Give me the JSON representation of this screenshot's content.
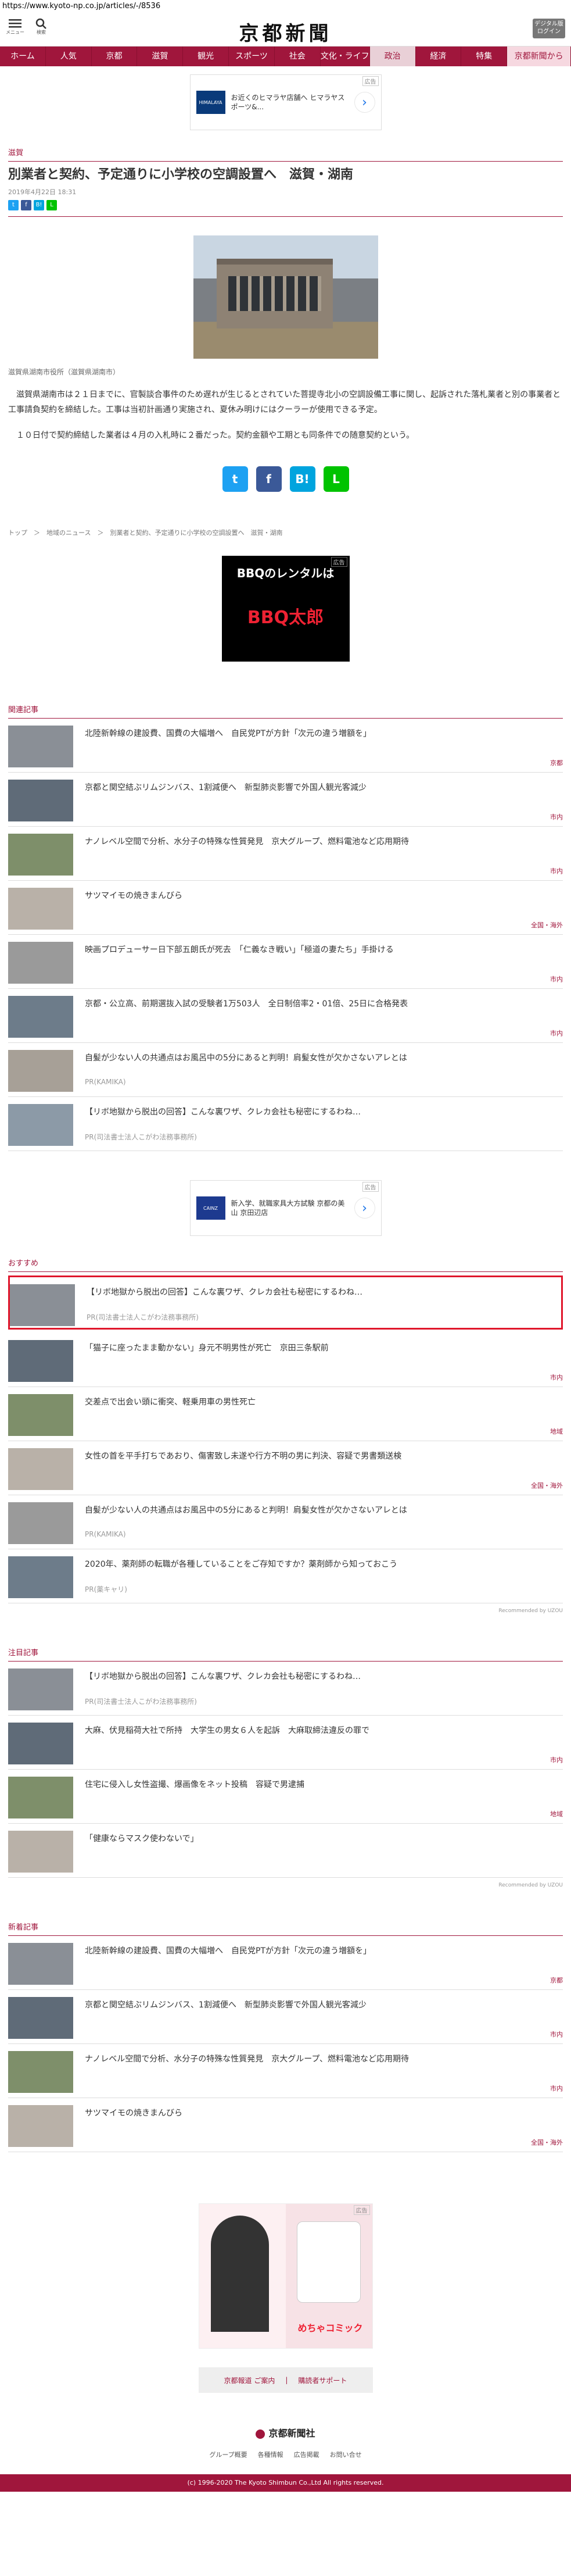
{
  "url": "https://www.kyoto-np.co.jp/articles/-/8536",
  "header": {
    "menu_label": "メニュー",
    "search_label": "検索",
    "logo": "京都新聞",
    "digital_btn": "デジタル版ログイン"
  },
  "nav": [
    "ホーム",
    "人気",
    "京都",
    "滋賀",
    "観光",
    "スポーツ",
    "社会",
    "文化・ライフ",
    "政治",
    "経済",
    "特集",
    "京都新聞から"
  ],
  "ads": {
    "top": {
      "tag": "広告",
      "logo": "HIMALAYA",
      "text": "お近くのヒマラヤ店舗へ ヒマラヤスポーツ&..."
    },
    "bbq": {
      "tag": "広告",
      "line1": "BBQのレンタルは",
      "line2": "BBQ太郎"
    },
    "mid": {
      "tag": "広告",
      "logo": "CAINZ",
      "text": "新入学、就職家具大方試験 京都の美山 京田辺店"
    },
    "manga": {
      "tag": "広告",
      "title": "めちゃコミック"
    }
  },
  "article": {
    "category": "滋賀",
    "headline": "別業者と契約、予定通りに小学校の空調設置へ　滋賀・湖南",
    "date": "2019年4月22日 18:31",
    "caption": "滋賀県湖南市役所（滋賀県湖南市）",
    "paragraphs": [
      "滋賀県湖南市は２１日までに、官製談合事件のため遅れが生じるとされていた菩提寺北小の空調設備工事に関し、起訴された落札業者と別の事業者と工事請負契約を締結した。工事は当初計画通り実施され、夏休み明けにはクーラーが使用できる予定。",
      "１０日付で契約締結した業者は４月の入札時に２番だった。契約金額や工期とも同条件での随意契約という。"
    ]
  },
  "share": {
    "twitter": "t",
    "facebook": "f",
    "hatena": "B!",
    "line": "L"
  },
  "breadcrumb": "トップ　＞　地域のニュース　＞　別業者と契約、予定通りに小学校の空調設置へ　滋賀・湖南",
  "related": {
    "heading": "関連記事",
    "items": [
      {
        "title": "北陸新幹線の建設費、国費の大幅増へ　自民党PTが方針「次元の違う増額を」",
        "tag": "京都"
      },
      {
        "title": "京都と関空結ぶリムジンバス、1割減便へ　新型肺炎影響で外国人観光客減少",
        "tag": "市内"
      },
      {
        "title": "ナノレベル空間で分析、水分子の特殊な性質発見　京大グループ、燃料電池など応用期待",
        "tag": "市内"
      },
      {
        "title": "サツマイモの焼きまんびら",
        "tag": "全国・海外"
      },
      {
        "title": "映画プロデューサー日下部五朗氏が死去　「仁義なき戦い」「極道の妻たち」手掛ける",
        "tag": "市内"
      },
      {
        "title": "京都・公立高、前期選抜入試の受験者1万503人　全日制倍率2・01倍、25日に合格発表",
        "tag": "市内"
      },
      {
        "title": "自髪が少ない人の共通点はお風呂中の5分にあると判明！肩髪女性が欠かさないアレとは",
        "pr": "PR(KAMIKA)"
      },
      {
        "title": "【リボ地獄から脱出の回答】こんな裏ワザ、クレカ会社も秘密にするわね…",
        "pr": "PR(司法書士法人こがわ法務事務所)"
      }
    ]
  },
  "recommend": {
    "heading": "おすすめ",
    "items": [
      {
        "title": "【リボ地獄から脱出の回答】こんな裏ワザ、クレカ会社も秘密にするわね…",
        "pr": "PR(司法書士法人こがわ法務事務所)"
      },
      {
        "title": "「猫子に座ったまま動かない」身元不明男性が死亡　京田三条駅前",
        "tag": "市内"
      },
      {
        "title": "交差点で出会い頭に衝突、軽乗用車の男性死亡",
        "tag": "地域"
      },
      {
        "title": "女性の首を平手打ちであおり、傷害致し未遂や行方不明の男に判決、容疑で男書類送検",
        "tag": "全国・海外"
      },
      {
        "title": "自髪が少ない人の共通点はお風呂中の5分にあると判明！肩髪女性が欠かさないアレとは",
        "pr": "PR(KAMIKA)"
      },
      {
        "title": "2020年、薬剤師の転職が各種していることをご存知ですか？薬剤師から知っておこう",
        "pr": "PR(薬キャリ)"
      }
    ],
    "recby": "Recommended by UZOU"
  },
  "notable": {
    "heading": "注目記事",
    "items": [
      {
        "title": "【リボ地獄から脱出の回答】こんな裏ワザ、クレカ会社も秘密にするわね…",
        "pr": "PR(司法書士法人こがわ法務事務所)"
      },
      {
        "title": "大麻、伏見稲荷大社で所持　大学生の男女６人を起訴　大麻取締法違反の罪で",
        "tag": "市内"
      },
      {
        "title": "住宅に侵入し女性盗撮、爆画像をネット投稿　容疑で男逮捕",
        "tag": "地域"
      },
      {
        "title": "「健康ならマスク使わないで」",
        "tag": ""
      }
    ],
    "recby": "Recommended by UZOU"
  },
  "latest": {
    "heading": "新着記事",
    "items": [
      {
        "title": "北陸新幹線の建設費、国費の大幅増へ　自民党PTが方針「次元の違う増額を」",
        "tag": "京都"
      },
      {
        "title": "京都と関空結ぶリムジンバス、1割減便へ　新型肺炎影響で外国人観光客減少",
        "tag": "市内"
      },
      {
        "title": "ナノレベル空間で分析、水分子の特殊な性質発見　京大グループ、燃料電池など応用期待",
        "tag": "市内"
      },
      {
        "title": "サツマイモの焼きまんびら",
        "tag": "全国・海外"
      }
    ]
  },
  "footer": {
    "link1": "京都報道 ご案内",
    "link2": "購読者サポート",
    "logo": "京都新聞社",
    "sub": [
      "グループ概要",
      "各種情報",
      "広告掲載",
      "お問い合せ"
    ],
    "copyright": "(c) 1996-2020 The Kyoto Shimbun Co.,Ltd All rights reserved."
  }
}
